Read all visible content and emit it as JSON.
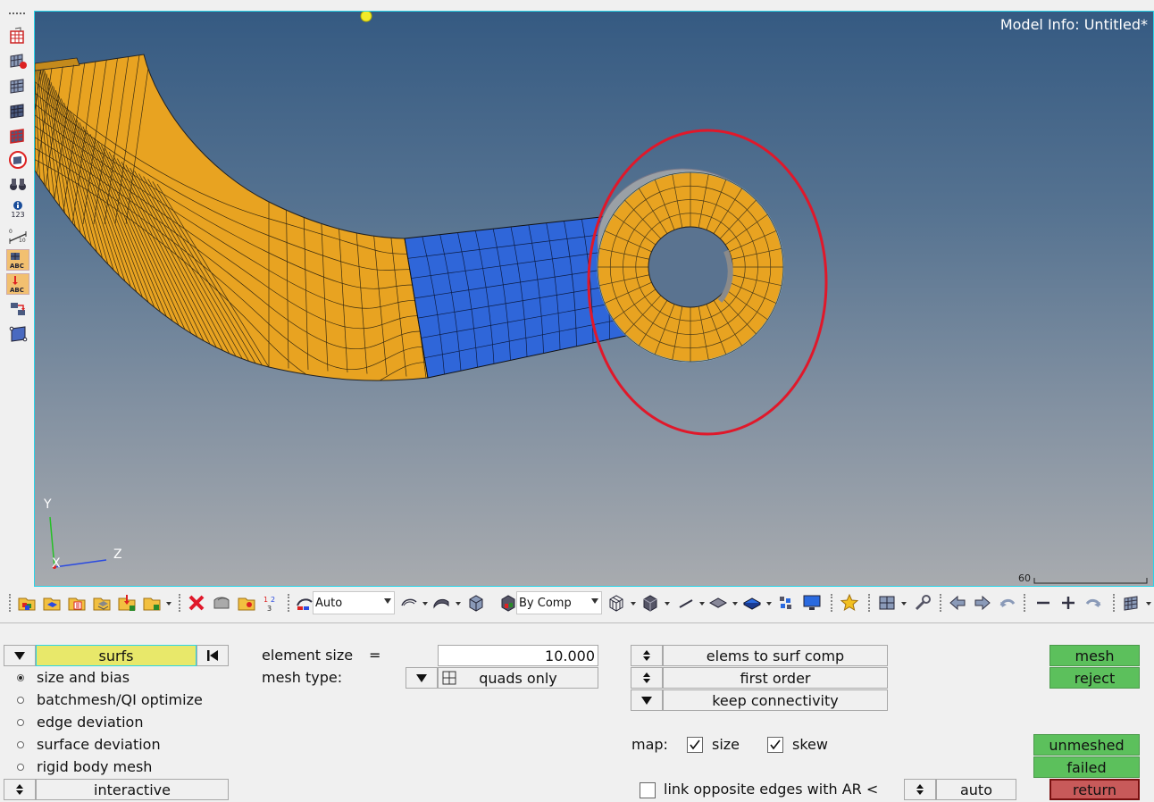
{
  "viewport": {
    "model_info": "Model Info: Untitled*",
    "axis_labels": {
      "y": "Y",
      "z": "Z",
      "x": "X"
    },
    "scale_value": "60",
    "colors": {
      "orange_comp": "#e8a321",
      "blue_comp": "#2f66d9",
      "highlight_circle": "#e0182a"
    }
  },
  "left_toolbar": {
    "icons": [
      "dots-menu-icon",
      "mesh-box-icon",
      "mesh-red-icon",
      "mesh-grid-icon",
      "mesh-dark-icon",
      "mesh-red-grid-icon",
      "mesh-circle-icon",
      "binoculars-icon",
      "info-123-icon",
      "ruler-icon",
      "abc-label-icon",
      "abc-red-label-icon",
      "transform-icon",
      "plane-icon"
    ],
    "info_text": "123",
    "abc_text": "ABC"
  },
  "bottom_toolbar": {
    "auto_label": "Auto",
    "bycomp_label": "By Comp"
  },
  "panel": {
    "selector": {
      "label": "surfs",
      "color": "#e8e86a"
    },
    "radios": [
      {
        "label": "size and bias",
        "selected": true
      },
      {
        "label": "batchmesh/QI optimize",
        "selected": false
      },
      {
        "label": "edge deviation",
        "selected": false
      },
      {
        "label": "surface deviation",
        "selected": false
      },
      {
        "label": "rigid body mesh",
        "selected": false
      }
    ],
    "interactive_label": "interactive",
    "element_size_label": "element size",
    "equals": "=",
    "element_size_value": "10.000",
    "mesh_type_label": "mesh type:",
    "mesh_type_value": "quads only",
    "elems_to_surf_comp": "elems to surf comp",
    "first_order": "first order",
    "keep_connectivity": "keep connectivity",
    "map_label": "map:",
    "size_label": "size",
    "size_checked": true,
    "skew_label": "skew",
    "skew_checked": true,
    "link_label": "link opposite edges with AR <",
    "link_checked": false,
    "auto_label": "auto",
    "mesh_btn": "mesh",
    "reject_btn": "reject",
    "unmeshed_btn": "unmeshed",
    "failed_btn": "failed",
    "return_btn": "return"
  }
}
